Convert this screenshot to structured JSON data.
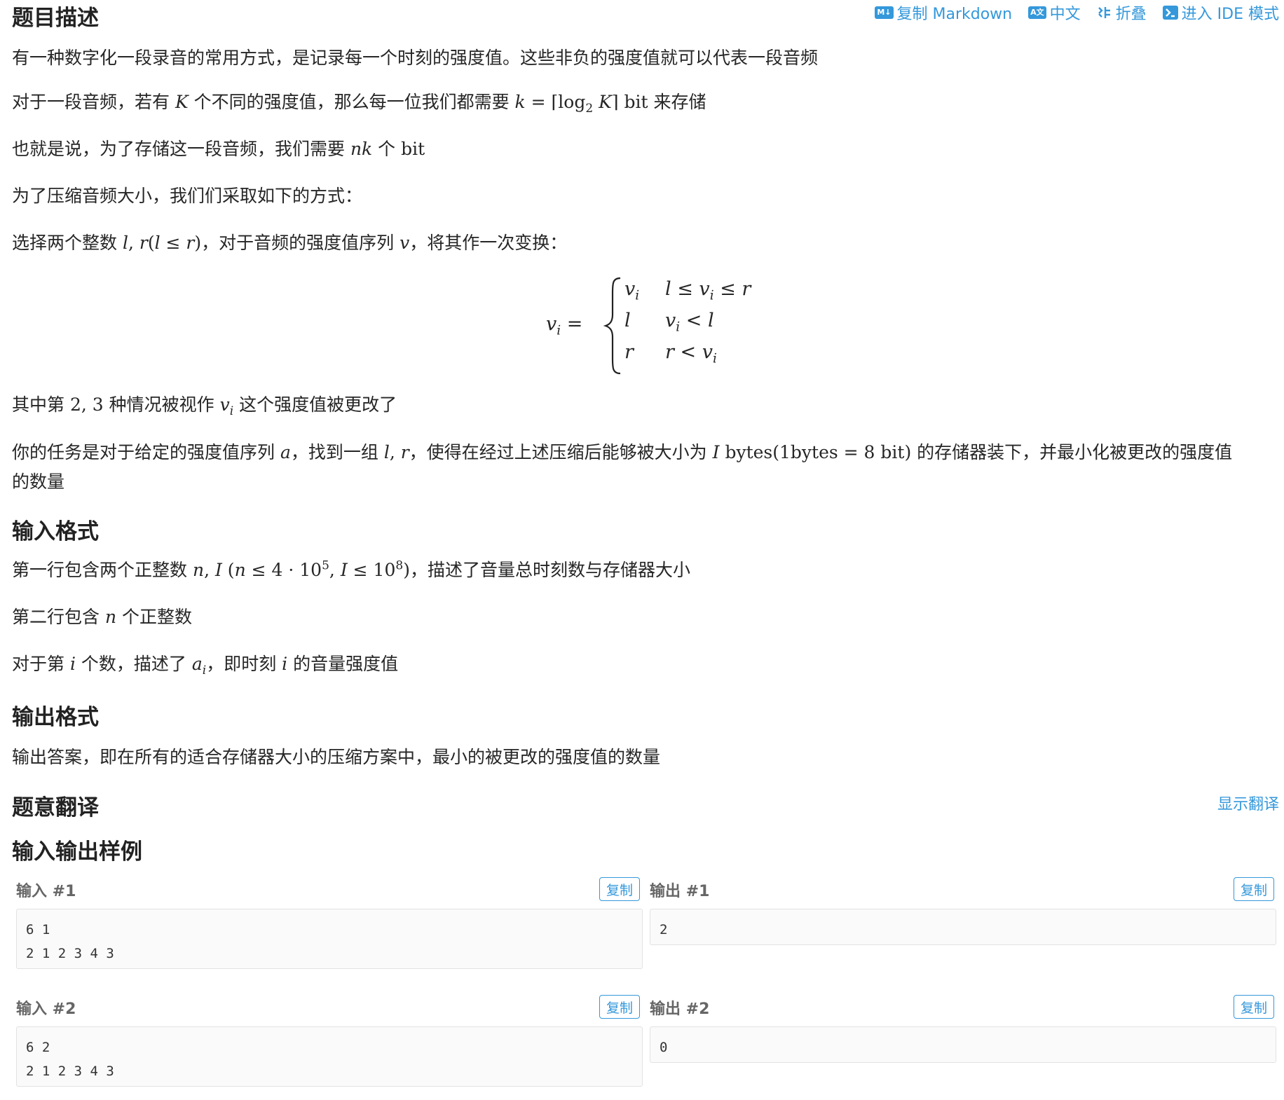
{
  "toolbar": {
    "copy_markdown": "复制 Markdown",
    "chinese": "中文",
    "fold": "折叠",
    "ide_mode": "进入 IDE 模式",
    "icons": [
      "markdown-icon",
      "translate-icon",
      "fold-icon",
      "terminal-icon"
    ],
    "accent": "#3498db"
  },
  "section": {
    "description": "题目描述",
    "input_format": "输入格式",
    "output_format": "输出格式",
    "translation": "题意翻译",
    "samples": "输入输出样例"
  },
  "desc": {
    "p1": "有一种数字化一段录音的常用方式，是记录每一个时刻的强度值。这些非负的强度值就可以代表一段音频",
    "p2_a": "对于一段音频，若有 ",
    "p2_b": " 个不同的强度值，那么每一位我们都需要 ",
    "p2_c": " 来存储",
    "p3_a": "也就是说，为了存储这一段音频，我们需要 ",
    "p3_b": " 个 ",
    "p4": "为了压缩音频大小，我们们采取如下的方式：",
    "p5_a": "选择两个整数 ",
    "p5_b": "，对于音频的强度值序列 ",
    "p5_c": "，将其作一次变换：",
    "p6_a": "其中第 ",
    "p6_b": " 种情况被视作 ",
    "p6_c": " 这个强度值被更改了",
    "p7_a": "你的任务是对于给定的强度值序列 ",
    "p7_b": "，找到一组 ",
    "p7_c": "，使得在经过上述压缩后能够被大小为 ",
    "p7_d": " 的存储器装下，并最小化被更改的强度值",
    "p7_e": "的数量"
  },
  "input": {
    "p1_a": "第一行包含两个正整数 ",
    "p1_b": "，描述了音量总时刻数与存储器大小",
    "p2_a": "第二行包含 ",
    "p2_b": " 个正整数",
    "p3_a": "对于第 ",
    "p3_b": " 个数，描述了 ",
    "p3_c": "，即时刻 ",
    "p3_d": " 的音量强度值"
  },
  "output": {
    "p1": "输出答案，即在所有的适合存储器大小的压缩方案中，最小的被更改的强度值的数量"
  },
  "translation": {
    "show": "显示翻译"
  },
  "samples": [
    {
      "input_label": "输入 #1",
      "output_label": "输出 #1",
      "copy": "复制",
      "input": "6 1\n2 1 2 3 4 3",
      "output": "2"
    },
    {
      "input_label": "输入 #2",
      "output_label": "输出 #2",
      "copy": "复制",
      "input": "6 2\n2 1 2 3 4 3",
      "output": "0"
    }
  ]
}
